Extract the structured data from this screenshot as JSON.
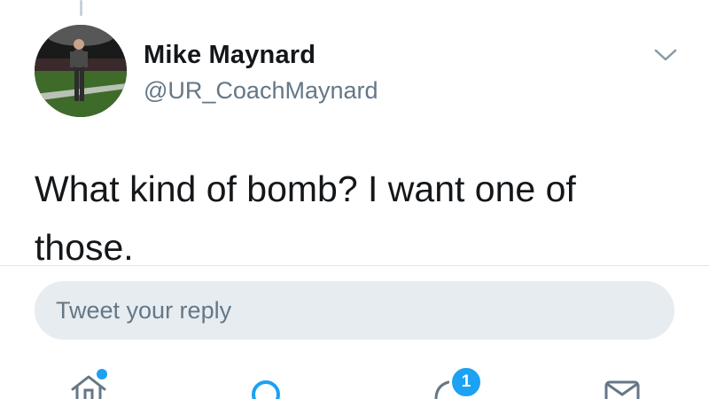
{
  "tweet": {
    "author_name": "Mike Maynard",
    "author_handle": "@UR_CoachMaynard",
    "text": "What kind of bomb?  I want one of those."
  },
  "reply": {
    "placeholder": "Tweet your reply"
  },
  "icons": {
    "more": "chevron-down-icon",
    "home": "home-icon",
    "search": "search-icon",
    "notifications": "notifications-icon",
    "messages": "mail-icon"
  },
  "tabbar": {
    "notifications_badge": "1"
  },
  "colors": {
    "accent": "#1da1f2",
    "text": "#14171a",
    "secondary_text": "#657786",
    "reply_box_bg": "#e6ecf0",
    "divider": "#e1e8ed"
  }
}
